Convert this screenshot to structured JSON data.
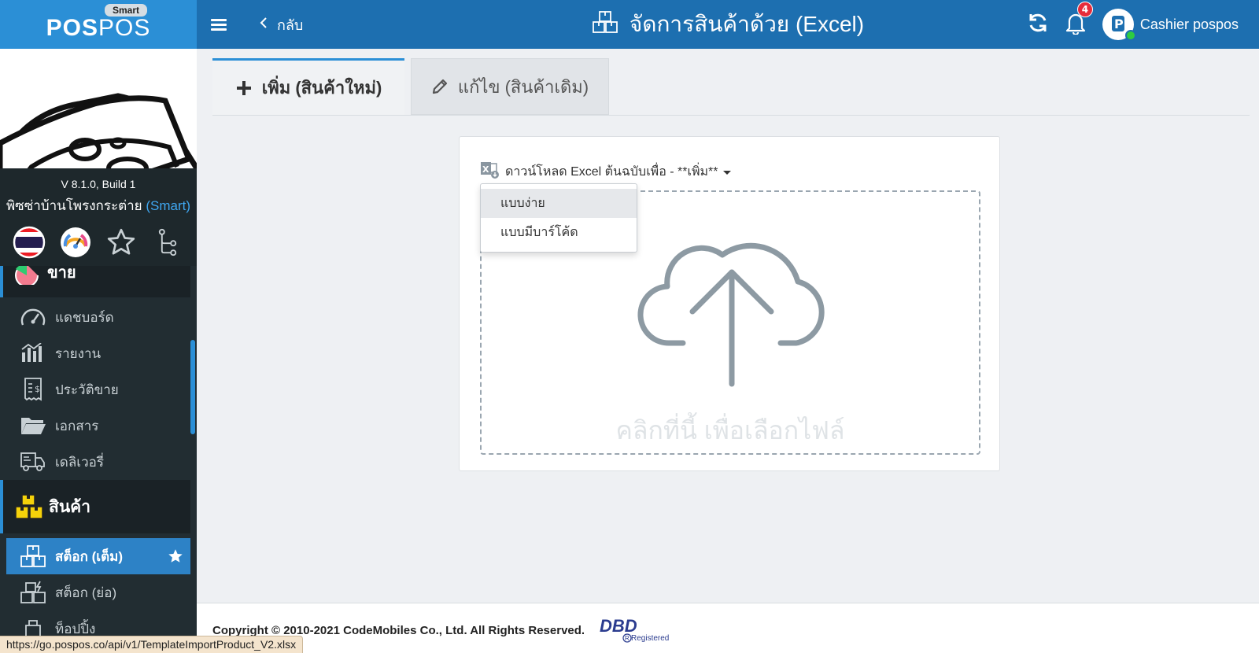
{
  "brand": {
    "logo_left": "POS",
    "logo_right": "POS",
    "badge": "Smart"
  },
  "sidebar": {
    "version": "V 8.1.0, Build 1",
    "store_name": "พิซซ่าบ้านโพรงกระต่าย",
    "store_tier": "(Smart)",
    "partial_label": "ขาย",
    "items": [
      {
        "label": "แดชบอร์ด",
        "icon": "speedometer-icon"
      },
      {
        "label": "รายงาน",
        "icon": "bar-chart-icon"
      },
      {
        "label": "ประวัติขาย",
        "icon": "receipt-icon"
      },
      {
        "label": "เอกสาร",
        "icon": "folder-icon"
      },
      {
        "label": "เดลิเวอรี่",
        "icon": "delivery-truck-icon"
      }
    ],
    "section_header": "สินค้า",
    "section_items": [
      {
        "label": "สต็อก (เต็ม)",
        "active": true
      },
      {
        "label": "สต็อก (ย่อ)",
        "active": false
      },
      {
        "label": "ท็อปปิ้ง",
        "active": false
      }
    ]
  },
  "header": {
    "back_label": "กลับ",
    "title": "จัดการสินค้าด้วย (Excel)",
    "notification_count": "4",
    "user_name": "Cashier pospos"
  },
  "tabs": {
    "add_label": "เพิ่ม (สินค้าใหม่)",
    "edit_label": "แก้ไข (สินค้าเดิม)"
  },
  "card": {
    "download_label": "ดาวน์โหลด Excel ต้นฉบับเพื่อ - **เพิ่ม**",
    "dropdown_options": [
      "แบบง่าย",
      "แบบมีบาร์โค้ด"
    ],
    "dropzone_text": "คลิกที่นี้ เพื่อเลือกไฟล์"
  },
  "footer": {
    "copyright": "Copyright © 2010-2021 CodeMobiles Co., Ltd. All Rights Reserved.",
    "dbd_logo": "DBD",
    "dbd_registered": "Registered"
  },
  "status_url": "https://go.pospos.co/api/v1/TemplateImportProduct_V2.xlsx",
  "colors": {
    "header": "#1d6fb0",
    "brand": "#2b8fd6",
    "sidebar": "#222d32",
    "active_item": "#2d82c6"
  }
}
